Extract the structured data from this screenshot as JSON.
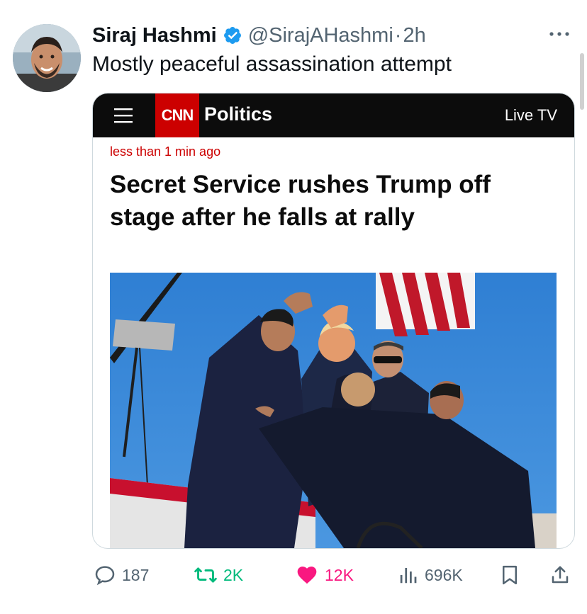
{
  "author": {
    "name": "Siraj Hashmi",
    "handle": "@SirajAHashmi",
    "separator": "·",
    "time": "2h"
  },
  "tweet_text": "Mostly peaceful assassination attempt",
  "embedded_article": {
    "logo_text": "CNN",
    "section": "Politics",
    "live_label": "Live TV",
    "timestamp": "less than 1 min ago",
    "headline": "Secret Service rushes Trump off stage after he falls at rally",
    "brand_color": "#cc0000"
  },
  "actions": {
    "replies": "187",
    "retweets": "2K",
    "likes": "12K",
    "views": "696K"
  },
  "icons": [
    "verified-badge-icon",
    "more-options-icon",
    "hamburger-menu-icon",
    "reply-icon",
    "retweet-icon",
    "like-icon",
    "views-icon",
    "bookmark-icon",
    "share-icon"
  ],
  "colors": {
    "retweet": "#00ba7c",
    "like": "#f91880",
    "secondary_text": "#536471",
    "verified": "#1d9bf0"
  }
}
